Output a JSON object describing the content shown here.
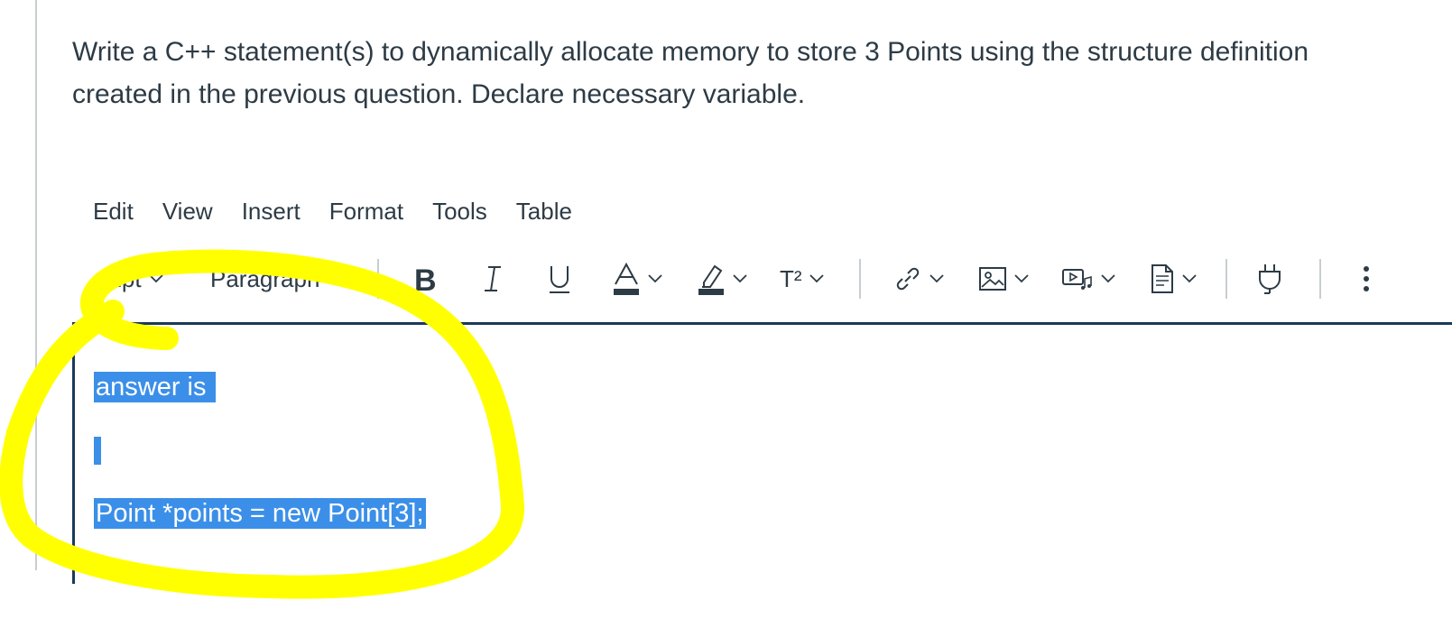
{
  "question": {
    "text": "Write a C++ statement(s) to dynamically allocate memory to store 3 Points using the structure definition created in the previous question. Declare necessary variable."
  },
  "menubar": {
    "edit": "Edit",
    "view": "View",
    "insert": "Insert",
    "format": "Format",
    "tools": "Tools",
    "table": "Table"
  },
  "toolbar": {
    "font_size": "12pt",
    "block_format": "Paragraph",
    "superscript_label": "T²",
    "icons": [
      "bold-icon",
      "italic-icon",
      "underline-icon",
      "text-color-icon",
      "highlight-icon",
      "superscript-icon",
      "link-icon",
      "image-icon",
      "media-icon",
      "document-icon",
      "plugin-icon",
      "more-options-icon"
    ]
  },
  "editor": {
    "lines": [
      "answer is ",
      "",
      "Point *points = new Point[3];"
    ]
  },
  "colors": {
    "selection": "#3b8fe8",
    "highlighter": "#ffff00",
    "editor_border": "#1a3a5a",
    "text": "#2d3b45"
  }
}
